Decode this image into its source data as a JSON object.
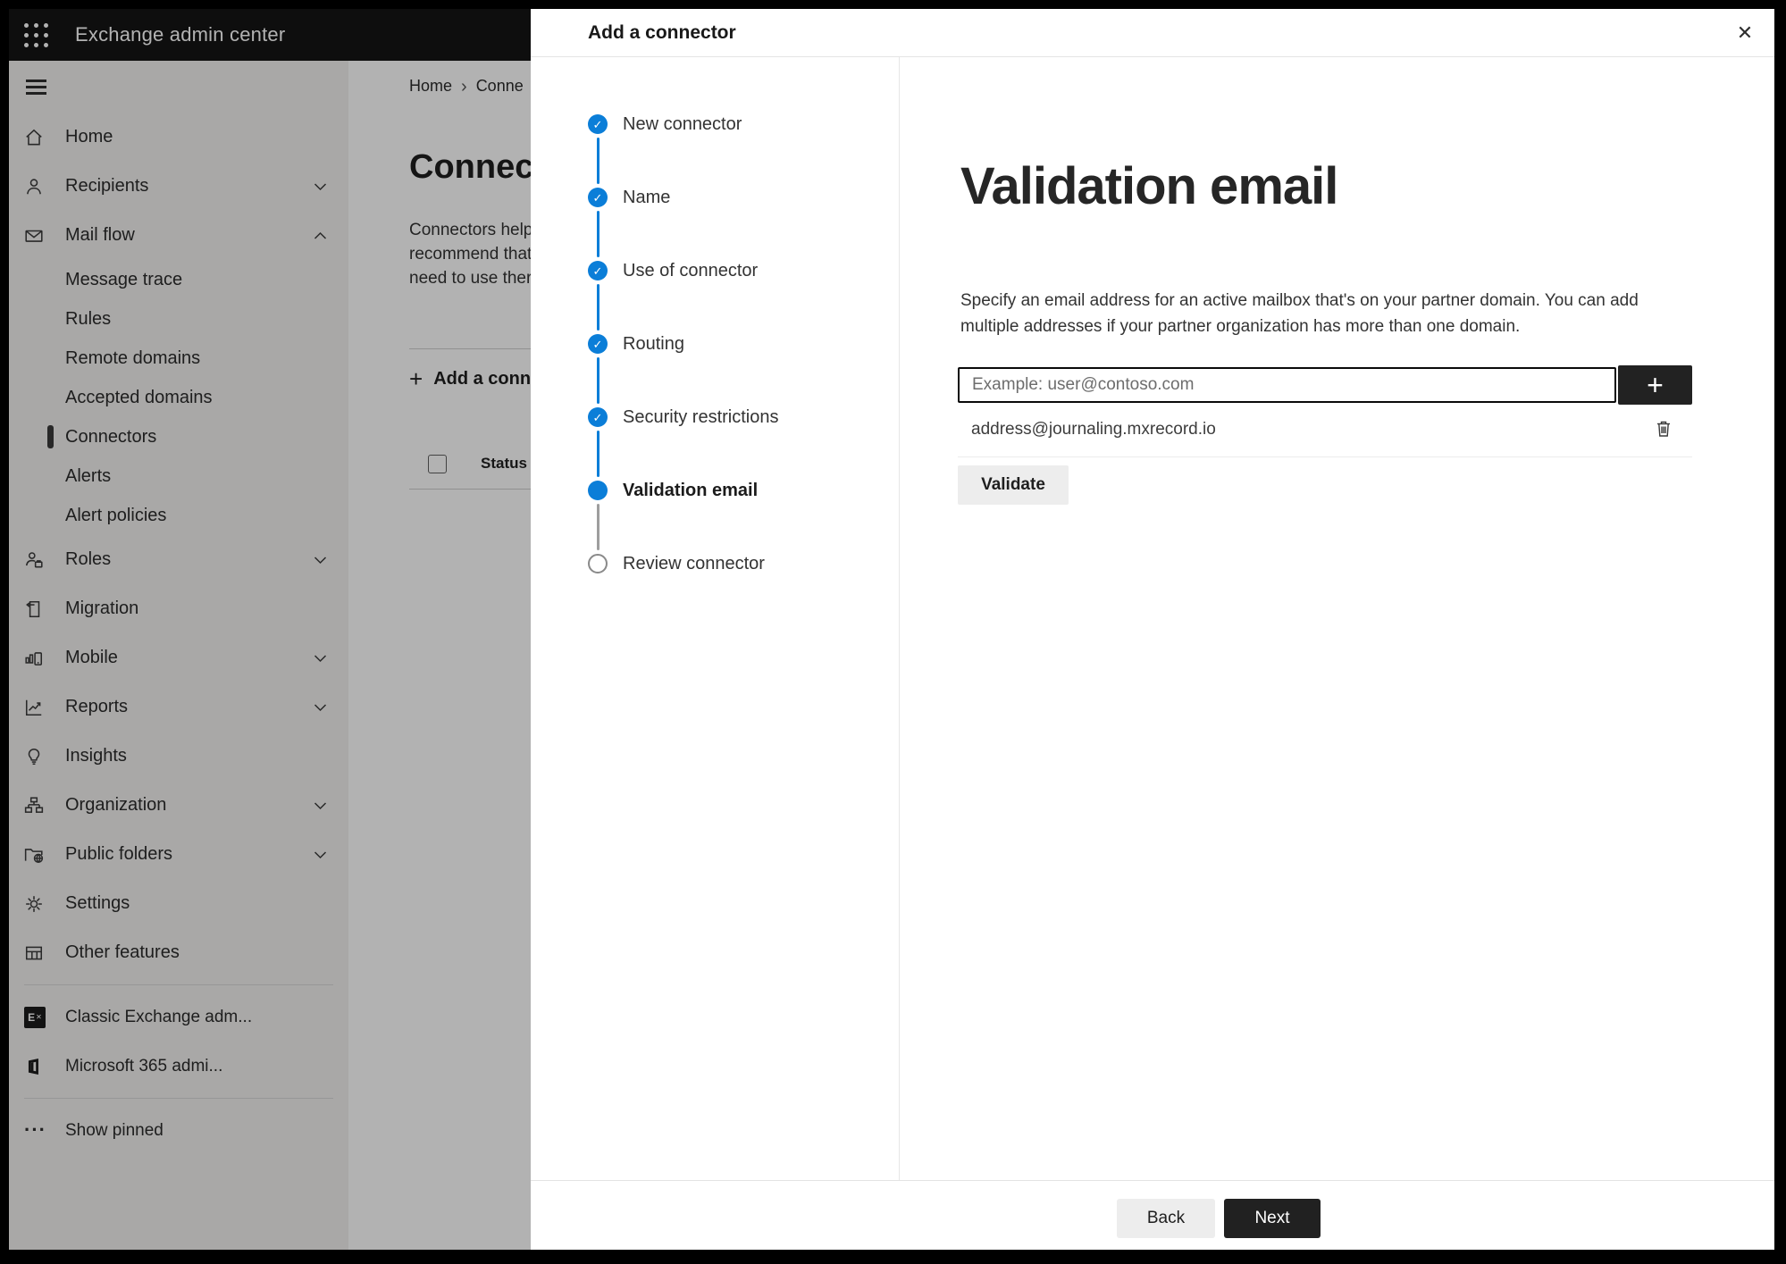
{
  "app": {
    "title": "Exchange admin center"
  },
  "colors": {
    "accent": "#0b7ed8",
    "header_bg": "#151515",
    "next_button_bg": "#212121"
  },
  "icons": {
    "plus": "+",
    "close": "✕",
    "check": "✓",
    "more": "···",
    "breadcrumb_separator": "›",
    "exchange_logo_letter": "E",
    "exchange_logo_x": "✕"
  },
  "breadcrumb": {
    "items": [
      "Home",
      "Conne"
    ]
  },
  "page_background": {
    "title": "Connec",
    "intro_lines": [
      "Connectors help",
      "recommend that",
      "need to use ther"
    ],
    "add_connector_label": "Add a conn",
    "table": {
      "column": "Status"
    }
  },
  "sidebar": {
    "items": [
      {
        "label": "Home",
        "icon": "home-icon"
      },
      {
        "label": "Recipients",
        "icon": "person-icon",
        "chevron": "down"
      },
      {
        "label": "Mail flow",
        "icon": "mail-icon",
        "chevron": "up",
        "expanded": true,
        "children": [
          {
            "label": "Message trace"
          },
          {
            "label": "Rules"
          },
          {
            "label": "Remote domains"
          },
          {
            "label": "Accepted domains"
          },
          {
            "label": "Connectors",
            "selected": true
          },
          {
            "label": "Alerts"
          },
          {
            "label": "Alert policies"
          }
        ]
      },
      {
        "label": "Roles",
        "icon": "roles-icon",
        "chevron": "down"
      },
      {
        "label": "Migration",
        "icon": "migration-icon"
      },
      {
        "label": "Mobile",
        "icon": "mobile-icon",
        "chevron": "down"
      },
      {
        "label": "Reports",
        "icon": "reports-icon",
        "chevron": "down"
      },
      {
        "label": "Insights",
        "icon": "lightbulb-icon"
      },
      {
        "label": "Organization",
        "icon": "org-chart-icon",
        "chevron": "down"
      },
      {
        "label": "Public folders",
        "icon": "public-folders-icon",
        "chevron": "down"
      },
      {
        "label": "Settings",
        "icon": "gear-icon"
      },
      {
        "label": "Other features",
        "icon": "table-icon"
      }
    ],
    "footer_items": [
      {
        "label": "Classic Exchange adm...",
        "icon": "exchange-logo-icon"
      },
      {
        "label": "Microsoft 365 admi...",
        "icon": "m365-logo-icon"
      }
    ],
    "show_pinned": "Show pinned"
  },
  "wizard": {
    "title": "Add a connector",
    "steps": [
      {
        "label": "New connector",
        "state": "done"
      },
      {
        "label": "Name",
        "state": "done"
      },
      {
        "label": "Use of connector",
        "state": "done"
      },
      {
        "label": "Routing",
        "state": "done"
      },
      {
        "label": "Security restrictions",
        "state": "done"
      },
      {
        "label": "Validation email",
        "state": "current"
      },
      {
        "label": "Review connector",
        "state": "todo"
      }
    ],
    "page": {
      "heading": "Validation email",
      "description": "Specify an email address for an active mailbox that's on your partner domain. You can add multiple addresses if your partner organization has more than one domain.",
      "email_input": {
        "placeholder": "Example: user@contoso.com",
        "value": ""
      },
      "added_addresses": [
        {
          "email": "address@journaling.mxrecord.io"
        }
      ],
      "validate_button": "Validate"
    },
    "footer": {
      "back_label": "Back",
      "next_label": "Next"
    }
  }
}
